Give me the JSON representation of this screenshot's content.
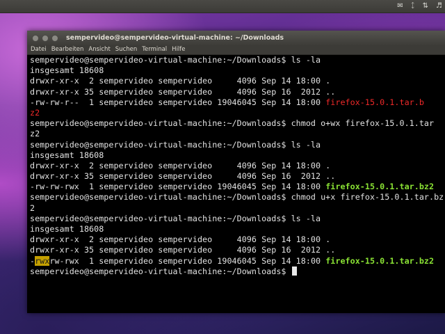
{
  "window": {
    "title": "sempervideo@sempervideo-virtual-machine: ~/Downloads",
    "menu": [
      "Datei",
      "Bearbeiten",
      "Ansicht",
      "Suchen",
      "Terminal",
      "Hilfe"
    ]
  },
  "colors": {
    "prompt_text": "#e2e2e2",
    "red_filename": "#ef2929",
    "green_filename": "#8ae234",
    "highlight": "#c4a000",
    "terminal_bg": "#000000"
  },
  "tray_icons": [
    "mail-icon",
    "bluetooth-icon",
    "network-icon",
    "volume-icon"
  ],
  "terminal": {
    "lines": [
      "sempervideo@sempervideo-virtual-machine:~/Downloads$ ls -la",
      "insgesamt 18608",
      "drwxr-xr-x  2 sempervideo sempervideo     4096 Sep 14 18:00 .",
      "drwxr-xr-x 35 sempervideo sempervideo     4096 Sep 16  2012 ..",
      {
        "text": "-rw-rw-r--  1 sempervideo sempervideo 19046045 Sep 14 18:00 ",
        "file": "firefox-15.0.1.tar.b",
        "fileColor": "red"
      },
      {
        "text": "",
        "file": "z2",
        "fileColor": "red"
      },
      "sempervideo@sempervideo-virtual-machine:~/Downloads$ chmod o+wx firefox-15.0.1.tar",
      "z2",
      "sempervideo@sempervideo-virtual-machine:~/Downloads$ ls -la",
      "insgesamt 18608",
      "drwxr-xr-x  2 sempervideo sempervideo     4096 Sep 14 18:00 .",
      "drwxr-xr-x 35 sempervideo sempervideo     4096 Sep 16  2012 ..",
      {
        "text": "-rw-rw-rwx  1 sempervideo sempervideo 19046045 Sep 14 18:00 ",
        "file": "firefox-15.0.1.tar.bz2",
        "fileColor": "green"
      },
      "sempervideo@sempervideo-virtual-machine:~/Downloads$ chmod u+x firefox-15.0.1.tar.bz",
      "2",
      "sempervideo@sempervideo-virtual-machine:~/Downloads$ ls -la",
      "insgesamt 18608",
      "drwxr-xr-x  2 sempervideo sempervideo     4096 Sep 14 18:00 .",
      "drwxr-xr-x 35 sempervideo sempervideo     4096 Sep 16  2012 ..",
      {
        "pre": "-",
        "hl": "rwx",
        "text": "rw-rwx  1 sempervideo sempervideo 19046045 Sep 14 18:00 ",
        "file": "firefox-15.0.1.tar.bz2",
        "fileColor": "green"
      },
      {
        "text": "sempervideo@sempervideo-virtual-machine:~/Downloads$ ",
        "cursor": true
      }
    ]
  }
}
